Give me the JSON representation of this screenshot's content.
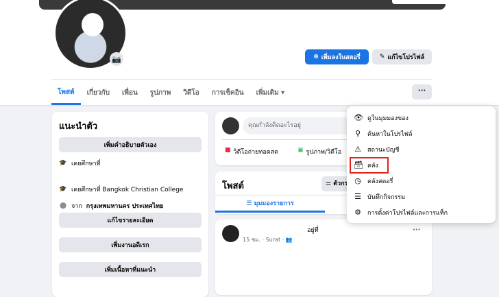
{
  "profile": {
    "add_story": "เพิ่มลงในสตอรี่",
    "edit_profile": "แก้ไขโปรไฟล์"
  },
  "tabs": [
    "โพสต์",
    "เกี่ยวกับ",
    "เพื่อน",
    "รูปภาพ",
    "วิดีโอ",
    "การเช็คอิน",
    "เพิ่มเติม ▾"
  ],
  "more_label": "···",
  "intro": {
    "title": "แนะนำตัว",
    "add_bio": "เพิ่มคำอธิบายตัวเอง",
    "studied1": "เคยศึกษาที่",
    "studied2": "เคยศึกษาที่ Bangkok Christian College",
    "from_prefix": "จาก",
    "from": "กรุงเทพมหานคร ประเทศไทย",
    "edit_details": "แก้ไขรายละเอียด",
    "add_hobbies": "เพิ่มงานอดิเรก",
    "add_featured": "เพิ่มเนื้อหาที่แนะนำ"
  },
  "composer": {
    "placeholder": "คุณกำลังคิดอะไรอยู่",
    "live": "วิดีโอถ่ายทอดสด",
    "photo": "รูปภาพ/วิดีโอ"
  },
  "posts": {
    "title": "โพสต์",
    "filter": "ตัวกรอง",
    "list_view": "☰ มุมมองรายการ"
  },
  "post": {
    "location": "อยู่ที่",
    "meta": "15 ชม. · Surat · 👥",
    "more": "···"
  },
  "menu": [
    {
      "icon": "eye-icon",
      "glyph": "👁",
      "label": "ดูในมุมมองของ"
    },
    {
      "icon": "search-icon",
      "glyph": "⚲",
      "label": "ค้นหาในโปรไฟล์"
    },
    {
      "icon": "warning-icon",
      "glyph": "⚠",
      "label": "สถานะบัญชี"
    },
    {
      "icon": "archive-icon",
      "glyph": "🗃",
      "label": "คลัง"
    },
    {
      "icon": "story-archive-icon",
      "glyph": "◷",
      "label": "คลังสตอรี่"
    },
    {
      "icon": "activity-log-icon",
      "glyph": "☰",
      "label": "บันทึกกิจกรรม"
    },
    {
      "icon": "profile-settings-icon",
      "glyph": "⚙",
      "label": "การตั้งค่าโปรไฟล์และการแท็ก"
    }
  ],
  "colors": {
    "accent": "#1b74e4",
    "highlight": "#e0201b"
  }
}
